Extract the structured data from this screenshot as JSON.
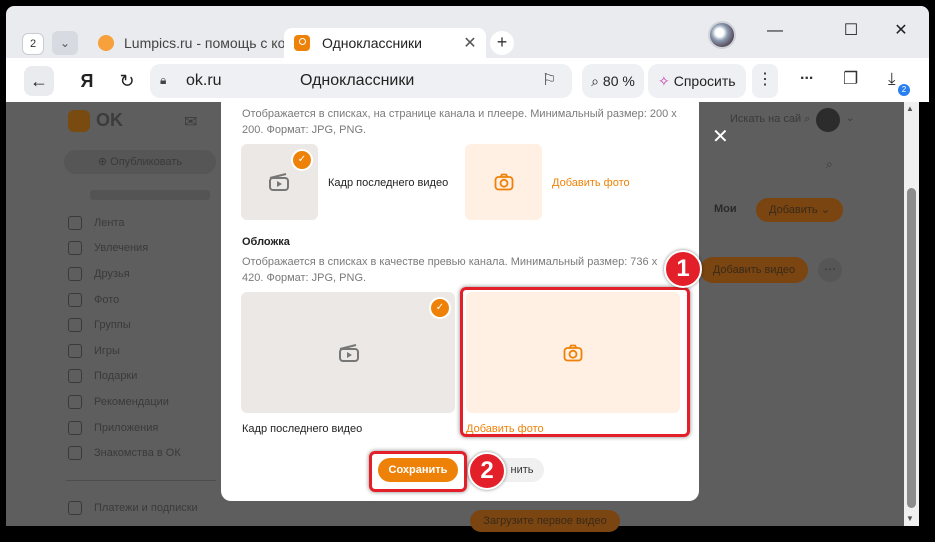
{
  "browser": {
    "tab_count": "2",
    "tabs": [
      {
        "title": "Lumpics.ru - помощь с ко"
      },
      {
        "title": "Одноклассники"
      }
    ],
    "new_tab": "+",
    "address": {
      "domain": "ok.ru",
      "title": "Одноклассники"
    },
    "zoom": "80 %",
    "ask_label": "Спросить",
    "downloads_badge": "2"
  },
  "site": {
    "logo_text": "OK",
    "publish": "Опубликовать",
    "search_placeholder": "Искать на сай",
    "sidebar": [
      "Лента",
      "Увлечения",
      "Друзья",
      "Фото",
      "Группы",
      "Игры",
      "Подарки",
      "Рекомендации",
      "Приложения",
      "Знакомства в ОК"
    ],
    "payments": "Платежи и подписки",
    "moi": "Мои",
    "add_button": "Добавить",
    "add_video": "Добавить видео",
    "upload_first": "Загрузите первое видео"
  },
  "modal": {
    "avatar_desc": "Отображается в списках, на странице канала и плеере. Минимальный размер: 200 x 200. Формат: JPG, PNG.",
    "avatar_option_label": "Кадр последнего видео",
    "avatar_add_photo": "Добавить фото",
    "cover_heading": "Обложка",
    "cover_desc": "Отображается в списках в качестве превью канала. Минимальный размер: 736 x 420. Формат: JPG, PNG.",
    "cover_option_label": "Кадр последнего видео",
    "cover_add_photo": "Добавить фото",
    "save": "Сохранить",
    "cancel": "нить"
  },
  "annotations": {
    "step1": "1",
    "step2": "2"
  },
  "colors": {
    "accent": "#ee8208",
    "annotation": "#e3202a"
  }
}
